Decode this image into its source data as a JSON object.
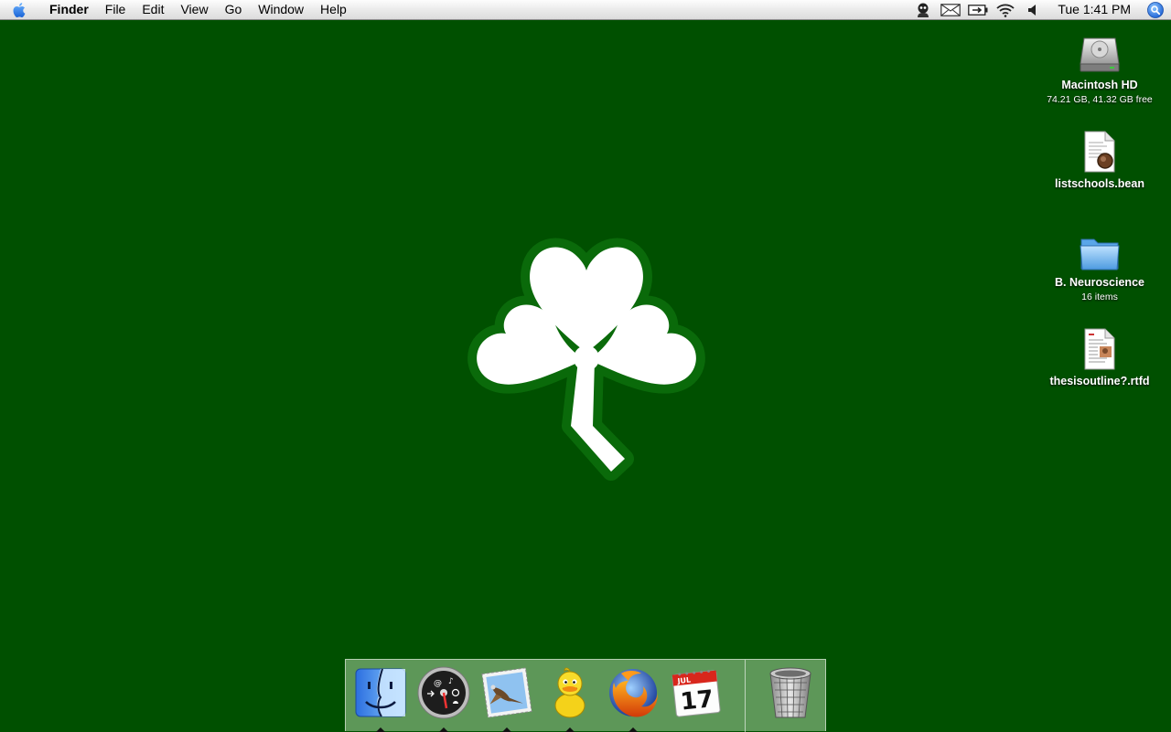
{
  "menubar": {
    "app_name": "Finder",
    "menus": [
      "File",
      "Edit",
      "View",
      "Go",
      "Window",
      "Help"
    ],
    "status_icons": [
      "user-icon",
      "mail-icon",
      "battery-icon",
      "wifi-icon",
      "volume-icon"
    ],
    "clock": "Tue 1:41 PM"
  },
  "desktop": {
    "background_color": "#005000",
    "icons": [
      {
        "name": "Macintosh HD",
        "info": "74.21 GB, 41.32 GB free",
        "icon": "hard-drive-icon"
      },
      {
        "name": "listschools.bean",
        "info": "",
        "icon": "document-icon"
      },
      {
        "name": "B. Neuroscience",
        "info": "16 items",
        "icon": "folder-icon"
      },
      {
        "name": "thesisoutline?.rtfd",
        "info": "",
        "icon": "rtf-document-icon"
      }
    ]
  },
  "dock": {
    "apps": [
      {
        "name": "Finder",
        "icon": "finder-icon",
        "running": true
      },
      {
        "name": "Dashboard",
        "icon": "dashboard-icon",
        "running": true
      },
      {
        "name": "Mail",
        "icon": "mail-app-icon",
        "running": true
      },
      {
        "name": "Adium",
        "icon": "adium-duck-icon",
        "running": true
      },
      {
        "name": "Firefox",
        "icon": "firefox-icon",
        "running": true
      },
      {
        "name": "iCal",
        "icon": "calendar-icon",
        "running": false,
        "month": "JUL",
        "day": "17"
      }
    ],
    "trash": {
      "name": "Trash",
      "icon": "trash-icon"
    }
  }
}
